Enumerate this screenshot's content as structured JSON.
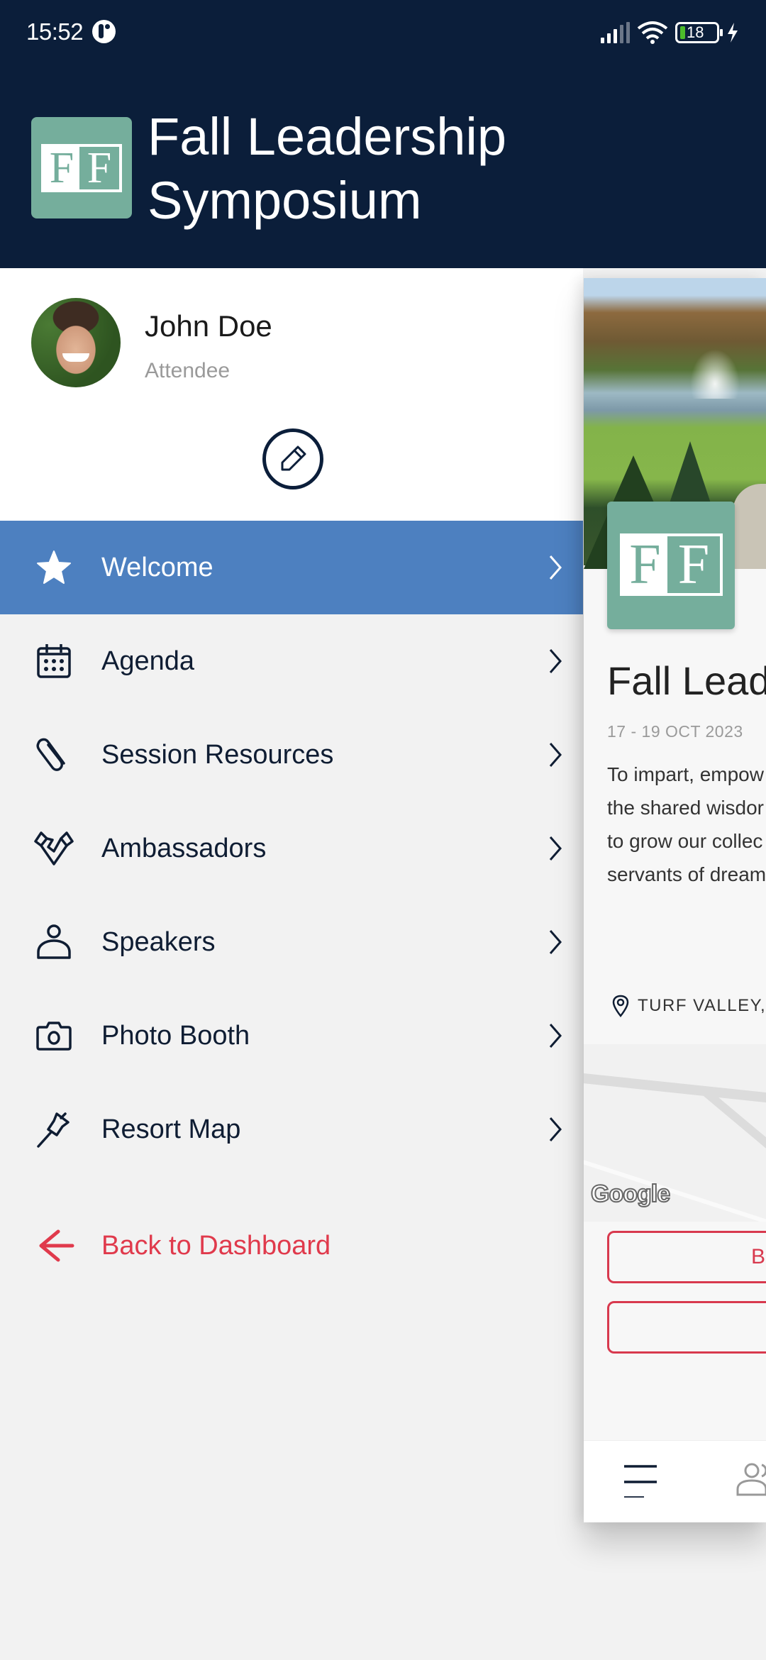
{
  "status_bar": {
    "time": "15:52",
    "battery_level": "18",
    "battery_percent": 18,
    "charging": true
  },
  "header": {
    "logo_letters": [
      "F",
      "F"
    ],
    "title_lines": [
      "Fall Leadership",
      "Symposium"
    ]
  },
  "profile": {
    "name": "John Doe",
    "role": "Attendee",
    "edit_icon": "pencil-icon"
  },
  "menu": {
    "items": [
      {
        "label": "Welcome",
        "icon": "star-icon",
        "active": true
      },
      {
        "label": "Agenda",
        "icon": "calendar-icon",
        "active": false
      },
      {
        "label": "Session Resources",
        "icon": "paperclip-icon",
        "active": false
      },
      {
        "label": "Ambassadors",
        "icon": "handshake-icon",
        "active": false
      },
      {
        "label": "Speakers",
        "icon": "person-icon",
        "active": false
      },
      {
        "label": "Photo Booth",
        "icon": "camera-icon",
        "active": false
      },
      {
        "label": "Resort Map",
        "icon": "pushpin-icon",
        "active": false
      }
    ],
    "back": {
      "label": "Back to Dashboard",
      "icon": "arrow-left-icon"
    }
  },
  "preview": {
    "title": "Fall Lead",
    "dates": "17 - 19 OCT 2023",
    "description_lines": [
      "To impart, empow",
      "the shared wisdor",
      "to grow our collec",
      "servants of dream"
    ],
    "location": "TURF VALLEY,",
    "map_attribution": "Google",
    "buttons": [
      {
        "label": "B"
      },
      {
        "label": ""
      }
    ],
    "bottom_nav": [
      "menu-icon",
      "people-icon"
    ]
  },
  "colors": {
    "header_bg": "#0b1e3a",
    "active_item_bg": "#4d80c0",
    "logo_bg": "#75ae9c",
    "back_link": "#e03a4c",
    "drawer_bg": "#f2f2f2"
  }
}
